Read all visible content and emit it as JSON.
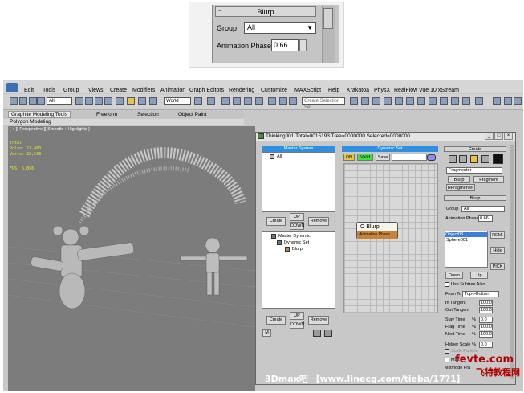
{
  "zoom": {
    "rollout_title": "Blurp",
    "rollout_minus": "-",
    "group_label": "Group",
    "group_value": "All",
    "anim_phase_label": "Animation Phase",
    "anim_phase_value": "0.66"
  },
  "menubar": {
    "items": [
      "Edit",
      "Tools",
      "Group",
      "Views",
      "Create",
      "Modifiers",
      "Animation",
      "Graph Editors",
      "Rendering",
      "Customize",
      "MAXScript",
      "Help",
      "Krakatoa",
      "PhysX",
      "RealFlow",
      "Vue 10 xStream"
    ]
  },
  "toolbar": {
    "filter_value": "All",
    "coord_value": "World",
    "selection_set_placeholder": "Create Selection Set"
  },
  "ribbon": {
    "tabs": [
      "Graphite Modeling Tools",
      "Freeform",
      "Selection",
      "Object Paint"
    ],
    "subtab": "Polygon Modeling"
  },
  "viewport": {
    "label": "[ + ][ Perspective ][ Smooth + Highlights ]",
    "stats": [
      "Total",
      "Polys: 23,480",
      "Verts: 22,533",
      "",
      "FPS:   5.856"
    ]
  },
  "thinking": {
    "title": "Thinking001  Total=0015193  Tree=0000000  Selected=0000000",
    "win_min": "_",
    "win_max": "□",
    "win_close": "×",
    "master_system_head": "Master System",
    "master_item": "All",
    "create_label": "Create",
    "up_label": "UP",
    "down_label": "DOWN",
    "remove_label": "Remove",
    "tree": [
      "Master Dynamic",
      "Dynamic Set",
      "Blurp"
    ],
    "create2_label": "Create",
    "up2_label": "UP",
    "down2_label": "DOWN",
    "remove2_label": "Remove",
    "m_label": "M",
    "dynamic_set_head": "Dynamic Set",
    "on_label": "ON",
    "valid_label": "Valid",
    "save_label": "Save",
    "node_title": "O Blurp",
    "node_sub": "Animation Phase"
  },
  "rpanel": {
    "create_head": "Create",
    "fragmenter_value": "Fragmenter",
    "blurp_btn": "Blurp",
    "fragment_btn": "Fragment",
    "hfragmenter_btn": "HFragmenter",
    "blurp_head": "Blurp",
    "group_label": "Group",
    "group_value": "All",
    "anim_label": "Animation Phase",
    "anim_value": "0.66",
    "objects": [
      "Object08",
      "Sphere001"
    ],
    "rem_btn": "REM.",
    "hide_btn": "Hide",
    "pick_btn": "PICK",
    "down_btn": "Down",
    "up_btn": "Up",
    "use_subtree": "Use Subtree Also",
    "from_to_label": "From To",
    "from_to_value": "Top->Bottom",
    "in_tangent_label": "In Tangent",
    "in_tangent_value": "100.0",
    "out_tangent_label": "Out Tangent",
    "out_tangent_value": "100.0",
    "stay_time_label": "Stay Time",
    "stay_time_value": "0.0",
    "frag_time_label": "Frag Time",
    "frag_time_value": "100.0",
    "next_time_label": "Next Time",
    "next_time_value": "100.0",
    "helper_scale_label": "Helper Scale",
    "helper_scale_value": "0.0",
    "scale_particle": "Scale Particle",
    "pct": "%",
    "matt_label": "Matt",
    "mixmode_label": "Mixmode Fra"
  },
  "watermark": {
    "site": "fevte.com",
    "cn": "飞特教程网",
    "bottom": "3Dmax吧 【www.linecg.com/tieba/17?1】"
  }
}
